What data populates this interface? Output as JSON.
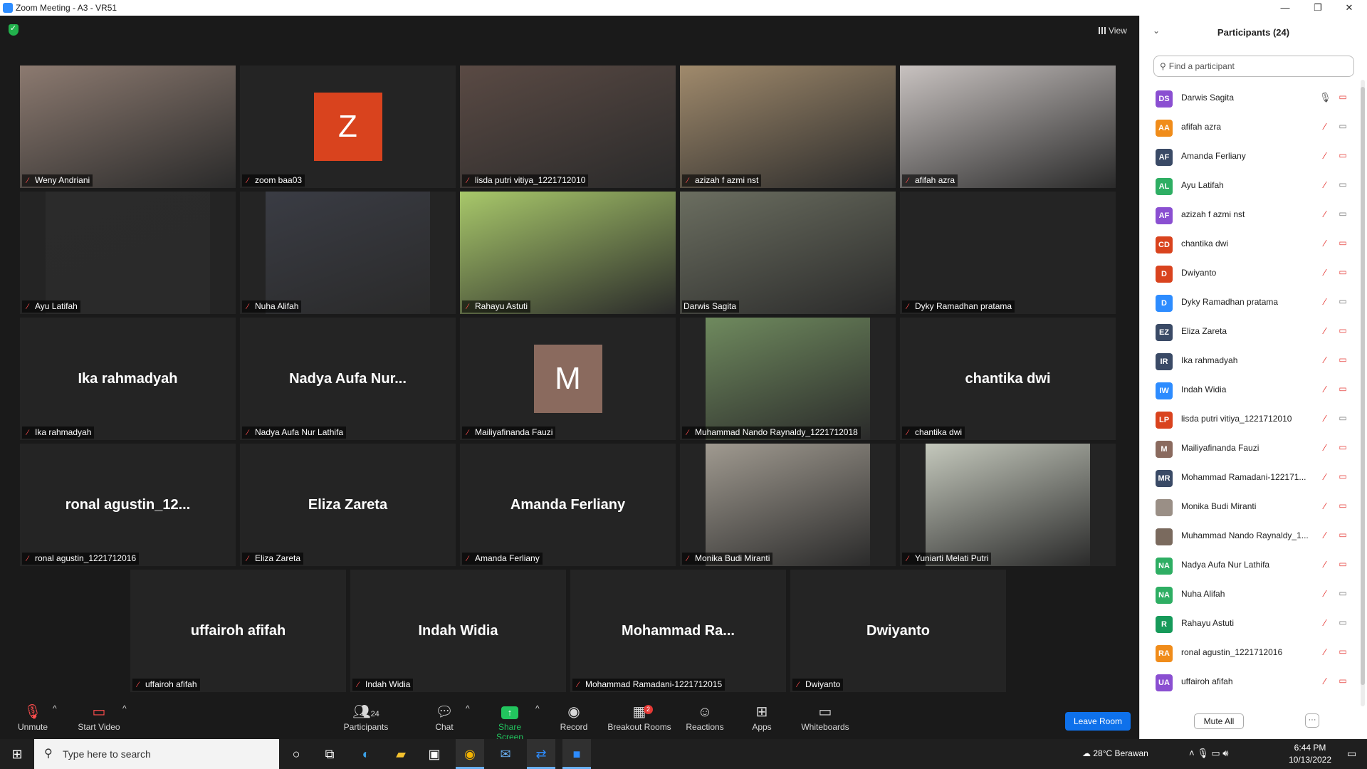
{
  "window": {
    "title": "Zoom Meeting - A3 - VR51",
    "minimize": "—",
    "maximize": "❐",
    "close": "✕"
  },
  "meeting": {
    "view_label": "View",
    "tiles": [
      {
        "name": "Weny Andriani",
        "kind": "video",
        "bg": "#8c7a70",
        "muted": true
      },
      {
        "name": "zoom baa03",
        "kind": "avatar",
        "avatar_letter": "Z",
        "avatar_color": "#d9431e",
        "muted": true
      },
      {
        "name": "lisda putri vitiya_1221712010",
        "kind": "video",
        "bg": "#5a4a44",
        "muted": true
      },
      {
        "name": "azizah f azmi nst",
        "kind": "video",
        "bg": "#a08a6c",
        "muted": true
      },
      {
        "name": "afifah azra",
        "kind": "video",
        "bg": "#c8c2c0",
        "muted": true
      },
      {
        "name": "Ayu Latifah",
        "kind": "video",
        "bg": "#2b2b2b",
        "muted": true
      },
      {
        "name": "Nuha Alifah",
        "kind": "video",
        "bg": "#3a3c44",
        "muted": true
      },
      {
        "name": "Rahayu Astuti",
        "kind": "video",
        "bg": "#a8c86a",
        "muted": true
      },
      {
        "name": "Darwis Sagita",
        "kind": "video",
        "bg": "#6b6e60",
        "muted": false,
        "active": true
      },
      {
        "name": "Dyky Ramadhan pratama",
        "kind": "blank",
        "muted": true
      },
      {
        "name": "Ika rahmadyah",
        "kind": "text",
        "display": "Ika rahmadyah",
        "muted": true
      },
      {
        "name": "Nadya Aufa Nur Lathifa",
        "kind": "text",
        "display": "Nadya  Aufa  Nur...",
        "muted": true
      },
      {
        "name": "Mailiyafinanda Fauzi",
        "kind": "avatar",
        "avatar_letter": "M",
        "avatar_color": "#8a6a5e",
        "muted": true
      },
      {
        "name": "Muhammad Nando Raynaldy_1221712018",
        "kind": "video",
        "bg": "#6f8a5e",
        "muted": true
      },
      {
        "name": "chantika dwi",
        "kind": "text",
        "display": "chantika dwi",
        "muted": true
      },
      {
        "name": "ronal agustin_1221712016",
        "kind": "text",
        "display": "ronal  agustin_12...",
        "muted": true
      },
      {
        "name": "Eliza Zareta",
        "kind": "text",
        "display": "Eliza Zareta",
        "muted": true
      },
      {
        "name": "Amanda Ferliany",
        "kind": "text",
        "display": "Amanda Ferliany",
        "muted": true
      },
      {
        "name": "Monika Budi Miranti",
        "kind": "video",
        "bg": "#a09a90",
        "muted": true
      },
      {
        "name": "Yuniarti Melati Putri",
        "kind": "video",
        "bg": "#c4c8bc",
        "muted": true
      },
      {
        "name": "uffairoh afifah",
        "kind": "text",
        "display": "uffairoh afifah",
        "muted": true
      },
      {
        "name": "Indah Widia",
        "kind": "text",
        "display": "Indah Widia",
        "muted": true
      },
      {
        "name": "Mohammad Ramadani-1221712015",
        "kind": "text",
        "display": "Mohammad  Ra...",
        "muted": true
      },
      {
        "name": "Dwiyanto",
        "kind": "text",
        "display": "Dwiyanto",
        "muted": true
      }
    ]
  },
  "toolbar": {
    "unmute": "Unmute",
    "start_video": "Start Video",
    "participants": "Participants",
    "participants_count": "24",
    "chat": "Chat",
    "share_screen": "Share Screen",
    "record": "Record",
    "breakout_rooms": "Breakout Rooms",
    "breakout_badge": "2",
    "reactions": "Reactions",
    "apps": "Apps",
    "whiteboards": "Whiteboards",
    "leave": "Leave Room"
  },
  "panel": {
    "title": "Participants (24)",
    "search_placeholder": "Find a participant",
    "mute_all": "Mute All",
    "more": "···",
    "participants": [
      {
        "initials": "DS",
        "name": "Darwis Sagita",
        "color": "#8a4fd1",
        "mic": "on",
        "cam": "off"
      },
      {
        "initials": "AA",
        "name": "afifah azra",
        "color": "#f08c1a",
        "mic": "muted",
        "cam": "on"
      },
      {
        "initials": "AF",
        "name": "Amanda Ferliany",
        "color": "#3a4a66",
        "mic": "muted",
        "cam": "off"
      },
      {
        "initials": "AL",
        "name": "Ayu Latifah",
        "color": "#2eae63",
        "mic": "muted",
        "cam": "on"
      },
      {
        "initials": "AF",
        "name": "azizah f azmi nst",
        "color": "#8a4fd1",
        "mic": "muted",
        "cam": "on"
      },
      {
        "initials": "CD",
        "name": "chantika dwi",
        "color": "#d9431e",
        "mic": "muted",
        "cam": "off"
      },
      {
        "initials": "D",
        "name": "Dwiyanto",
        "color": "#d9431e",
        "mic": "muted",
        "cam": "off"
      },
      {
        "initials": "D",
        "name": "Dyky Ramadhan pratama",
        "color": "#2d8cff",
        "mic": "muted",
        "cam": "on"
      },
      {
        "initials": "EZ",
        "name": "Eliza Zareta",
        "color": "#3a4a66",
        "mic": "muted",
        "cam": "off"
      },
      {
        "initials": "IR",
        "name": "Ika rahmadyah",
        "color": "#3a4a66",
        "mic": "muted",
        "cam": "off"
      },
      {
        "initials": "IW",
        "name": "Indah Widia",
        "color": "#2d8cff",
        "mic": "muted",
        "cam": "off"
      },
      {
        "initials": "LP",
        "name": "lisda putri vitiya_1221712010",
        "color": "#d9431e",
        "mic": "muted",
        "cam": "on"
      },
      {
        "initials": "M",
        "name": "Mailiyafinanda Fauzi",
        "color": "#8a6a5e",
        "mic": "muted",
        "cam": "off"
      },
      {
        "initials": "MR",
        "name": "Mohammad Ramadani-122171...",
        "color": "#3a4a66",
        "mic": "muted",
        "cam": "off"
      },
      {
        "initials": "",
        "name": "Monika Budi Miranti",
        "color": "#9a8f86",
        "mic": "muted",
        "cam": "off"
      },
      {
        "initials": "",
        "name": "Muhammad Nando Raynaldy_1...",
        "color": "#7a6a5e",
        "mic": "muted",
        "cam": "off"
      },
      {
        "initials": "NA",
        "name": "Nadya Aufa Nur Lathifa",
        "color": "#2eae63",
        "mic": "muted",
        "cam": "off"
      },
      {
        "initials": "NA",
        "name": "Nuha Alifah",
        "color": "#2eae63",
        "mic": "muted",
        "cam": "on"
      },
      {
        "initials": "R",
        "name": "Rahayu Astuti",
        "color": "#169a5a",
        "mic": "muted",
        "cam": "on"
      },
      {
        "initials": "RA",
        "name": "ronal agustin_1221712016",
        "color": "#f08c1a",
        "mic": "muted",
        "cam": "off"
      },
      {
        "initials": "UA",
        "name": "uffairoh afifah",
        "color": "#8a4fd1",
        "mic": "muted",
        "cam": "off"
      }
    ]
  },
  "taskbar": {
    "search_placeholder": "Type here to search",
    "weather": "28°C  Berawan",
    "time": "6:44 PM",
    "date": "10/13/2022"
  }
}
